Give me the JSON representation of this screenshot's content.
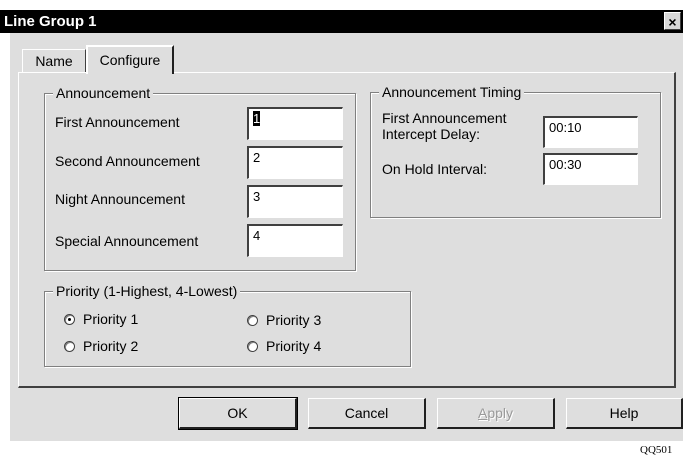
{
  "window": {
    "title": "Line Group 1",
    "close_glyph": "×"
  },
  "tabs": [
    {
      "label": "Name",
      "active": false
    },
    {
      "label": "Configure",
      "active": true
    }
  ],
  "announcement": {
    "legend": "Announcement",
    "fields": [
      {
        "label": "First Announcement",
        "value": "1"
      },
      {
        "label": "Second Announcement",
        "value": "2"
      },
      {
        "label": "Night Announcement",
        "value": "3"
      },
      {
        "label": "Special Announcement",
        "value": "4"
      }
    ]
  },
  "timing": {
    "legend": "Announcement Timing",
    "first_label_line1": "First Announcement",
    "first_label_line2": "Intercept Delay:",
    "first_value": "00:10",
    "hold_label": "On Hold Interval:",
    "hold_value": "00:30"
  },
  "priority": {
    "legend": "Priority (1-Highest, 4-Lowest)",
    "options": [
      {
        "label": "Priority 1",
        "checked": true
      },
      {
        "label": "Priority 2",
        "checked": false
      },
      {
        "label": "Priority 3",
        "checked": false
      },
      {
        "label": "Priority 4",
        "checked": false
      }
    ]
  },
  "buttons": {
    "ok": "OK",
    "cancel": "Cancel",
    "apply_first": "A",
    "apply_rest": "pply",
    "help": "Help"
  },
  "figure_ref": "QQ501"
}
